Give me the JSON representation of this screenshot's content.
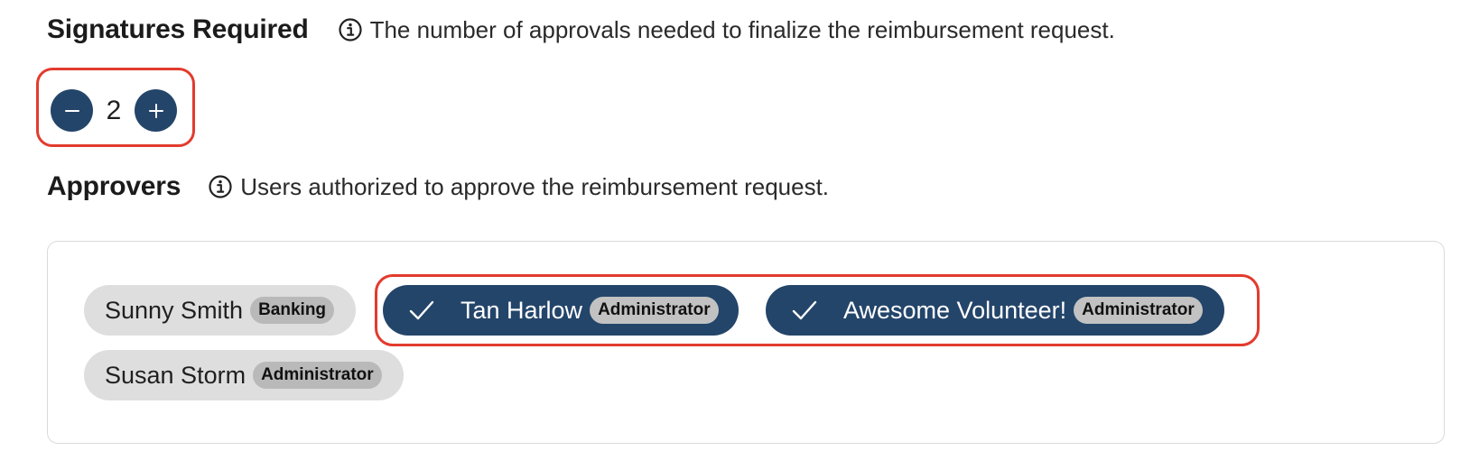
{
  "signatures": {
    "title": "Signatures Required",
    "hint": "The number of approvals needed to finalize the reimbursement request.",
    "value": "2",
    "decrement_icon": "minus-icon",
    "increment_icon": "plus-icon"
  },
  "approvers": {
    "title": "Approvers",
    "hint": "Users authorized to approve the reimbursement request.",
    "items": [
      {
        "name": "Sunny Smith",
        "role": "Banking",
        "selected": false
      },
      {
        "name": "Tan Harlow",
        "role": "Administrator",
        "selected": true
      },
      {
        "name": "Awesome Volunteer!",
        "role": "Administrator",
        "selected": true
      },
      {
        "name": "Susan Storm",
        "role": "Administrator",
        "selected": false
      }
    ]
  },
  "colors": {
    "accent": "#24456a",
    "highlight": "#e23b2e",
    "chip_unselected": "#dedede",
    "badge": "#b9b9b9"
  },
  "icons": {
    "info": "info-icon",
    "check": "check-icon"
  }
}
